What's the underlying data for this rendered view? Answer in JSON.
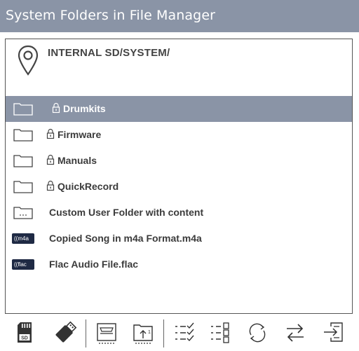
{
  "header": {
    "title": "System Folders in File Manager"
  },
  "location": {
    "path": "INTERNAL SD/SYSTEM/",
    "icon": "location-pin-icon"
  },
  "files": [
    {
      "name": "Drumkits",
      "type": "folder",
      "locked": true,
      "selected": true
    },
    {
      "name": "Firmware",
      "type": "folder",
      "locked": true,
      "selected": false
    },
    {
      "name": "Manuals",
      "type": "folder",
      "locked": true,
      "selected": false
    },
    {
      "name": "QuickRecord",
      "type": "folder",
      "locked": true,
      "selected": false
    },
    {
      "name": "Custom User Folder with content",
      "type": "folder-with-content",
      "locked": false,
      "selected": false
    },
    {
      "name": "Copied Song in m4a Format.m4a",
      "type": "m4a",
      "badge": "m4a",
      "locked": false,
      "selected": false
    },
    {
      "name": "Flac Audio File.flac",
      "type": "flac",
      "badge": "flac",
      "locked": false,
      "selected": false
    }
  ],
  "toolbar": {
    "sd_label": "SD",
    "buttons": [
      "sd-card-icon",
      "usb-drive-icon",
      "storage-tray-icon",
      "upload-folder-icon",
      "checklist-icon",
      "list-boxes-icon",
      "refresh-icon",
      "swap-arrows-icon",
      "export-icon"
    ]
  },
  "colors": {
    "titlebar": "#8a94a6",
    "selected_row": "#8a94a6",
    "badge": "#1f2a44"
  }
}
